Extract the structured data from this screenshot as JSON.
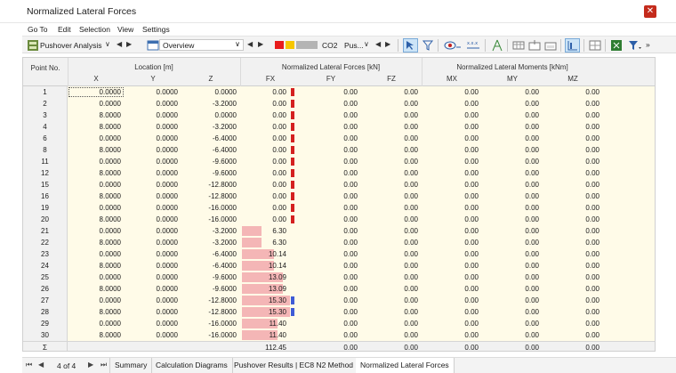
{
  "window": {
    "title": "Normalized Lateral Forces"
  },
  "menu": [
    "Go To",
    "Edit",
    "Selection",
    "View",
    "Settings"
  ],
  "toolbar": {
    "analysis_label": "Pushover Analysis",
    "view_label": "Overview",
    "combo_code": "CO2",
    "combo_name": "Pus...",
    "colors": {
      "red": "#e81c1c",
      "yellow": "#f7c600",
      "gray": "#b4b4b4"
    }
  },
  "table": {
    "headers": {
      "point_no": "Point No.",
      "location": "Location [m]",
      "forces": "Normalized Lateral Forces [kN]",
      "moments": "Normalized Lateral Moments [kNm]",
      "cols": [
        "X",
        "Y",
        "Z",
        "FX",
        "FY",
        "FZ",
        "MX",
        "MY",
        "MZ"
      ]
    },
    "rows": [
      {
        "no": "1",
        "x": "0.0000",
        "y": "0.0000",
        "z": "0.0000",
        "fx": "0.00",
        "fy": "0.00",
        "fz": "0.00",
        "mx": "0.00",
        "my": "0.00",
        "mz": "0.00",
        "fx_val": 0.0,
        "mark": "red"
      },
      {
        "no": "2",
        "x": "0.0000",
        "y": "0.0000",
        "z": "-3.2000",
        "fx": "0.00",
        "fy": "0.00",
        "fz": "0.00",
        "mx": "0.00",
        "my": "0.00",
        "mz": "0.00",
        "fx_val": 0.0,
        "mark": "red"
      },
      {
        "no": "3",
        "x": "8.0000",
        "y": "0.0000",
        "z": "0.0000",
        "fx": "0.00",
        "fy": "0.00",
        "fz": "0.00",
        "mx": "0.00",
        "my": "0.00",
        "mz": "0.00",
        "fx_val": 0.0,
        "mark": "red"
      },
      {
        "no": "4",
        "x": "8.0000",
        "y": "0.0000",
        "z": "-3.2000",
        "fx": "0.00",
        "fy": "0.00",
        "fz": "0.00",
        "mx": "0.00",
        "my": "0.00",
        "mz": "0.00",
        "fx_val": 0.0,
        "mark": "red"
      },
      {
        "no": "6",
        "x": "0.0000",
        "y": "0.0000",
        "z": "-6.4000",
        "fx": "0.00",
        "fy": "0.00",
        "fz": "0.00",
        "mx": "0.00",
        "my": "0.00",
        "mz": "0.00",
        "fx_val": 0.0,
        "mark": "red"
      },
      {
        "no": "8",
        "x": "8.0000",
        "y": "0.0000",
        "z": "-6.4000",
        "fx": "0.00",
        "fy": "0.00",
        "fz": "0.00",
        "mx": "0.00",
        "my": "0.00",
        "mz": "0.00",
        "fx_val": 0.0,
        "mark": "red"
      },
      {
        "no": "11",
        "x": "0.0000",
        "y": "0.0000",
        "z": "-9.6000",
        "fx": "0.00",
        "fy": "0.00",
        "fz": "0.00",
        "mx": "0.00",
        "my": "0.00",
        "mz": "0.00",
        "fx_val": 0.0,
        "mark": "red"
      },
      {
        "no": "12",
        "x": "8.0000",
        "y": "0.0000",
        "z": "-9.6000",
        "fx": "0.00",
        "fy": "0.00",
        "fz": "0.00",
        "mx": "0.00",
        "my": "0.00",
        "mz": "0.00",
        "fx_val": 0.0,
        "mark": "red"
      },
      {
        "no": "15",
        "x": "0.0000",
        "y": "0.0000",
        "z": "-12.8000",
        "fx": "0.00",
        "fy": "0.00",
        "fz": "0.00",
        "mx": "0.00",
        "my": "0.00",
        "mz": "0.00",
        "fx_val": 0.0,
        "mark": "red"
      },
      {
        "no": "16",
        "x": "8.0000",
        "y": "0.0000",
        "z": "-12.8000",
        "fx": "0.00",
        "fy": "0.00",
        "fz": "0.00",
        "mx": "0.00",
        "my": "0.00",
        "mz": "0.00",
        "fx_val": 0.0,
        "mark": "red"
      },
      {
        "no": "19",
        "x": "0.0000",
        "y": "0.0000",
        "z": "-16.0000",
        "fx": "0.00",
        "fy": "0.00",
        "fz": "0.00",
        "mx": "0.00",
        "my": "0.00",
        "mz": "0.00",
        "fx_val": 0.0,
        "mark": "red"
      },
      {
        "no": "20",
        "x": "8.0000",
        "y": "0.0000",
        "z": "-16.0000",
        "fx": "0.00",
        "fy": "0.00",
        "fz": "0.00",
        "mx": "0.00",
        "my": "0.00",
        "mz": "0.00",
        "fx_val": 0.0,
        "mark": "red"
      },
      {
        "no": "21",
        "x": "0.0000",
        "y": "0.0000",
        "z": "-3.2000",
        "fx": "6.30",
        "fy": "0.00",
        "fz": "0.00",
        "mx": "0.00",
        "my": "0.00",
        "mz": "0.00",
        "fx_val": 6.3,
        "mark": ""
      },
      {
        "no": "22",
        "x": "8.0000",
        "y": "0.0000",
        "z": "-3.2000",
        "fx": "6.30",
        "fy": "0.00",
        "fz": "0.00",
        "mx": "0.00",
        "my": "0.00",
        "mz": "0.00",
        "fx_val": 6.3,
        "mark": ""
      },
      {
        "no": "23",
        "x": "0.0000",
        "y": "0.0000",
        "z": "-6.4000",
        "fx": "10.14",
        "fy": "0.00",
        "fz": "0.00",
        "mx": "0.00",
        "my": "0.00",
        "mz": "0.00",
        "fx_val": 10.14,
        "mark": ""
      },
      {
        "no": "24",
        "x": "8.0000",
        "y": "0.0000",
        "z": "-6.4000",
        "fx": "10.14",
        "fy": "0.00",
        "fz": "0.00",
        "mx": "0.00",
        "my": "0.00",
        "mz": "0.00",
        "fx_val": 10.14,
        "mark": ""
      },
      {
        "no": "25",
        "x": "0.0000",
        "y": "0.0000",
        "z": "-9.6000",
        "fx": "13.09",
        "fy": "0.00",
        "fz": "0.00",
        "mx": "0.00",
        "my": "0.00",
        "mz": "0.00",
        "fx_val": 13.09,
        "mark": ""
      },
      {
        "no": "26",
        "x": "8.0000",
        "y": "0.0000",
        "z": "-9.6000",
        "fx": "13.09",
        "fy": "0.00",
        "fz": "0.00",
        "mx": "0.00",
        "my": "0.00",
        "mz": "0.00",
        "fx_val": 13.09,
        "mark": ""
      },
      {
        "no": "27",
        "x": "0.0000",
        "y": "0.0000",
        "z": "-12.8000",
        "fx": "15.30",
        "fy": "0.00",
        "fz": "0.00",
        "mx": "0.00",
        "my": "0.00",
        "mz": "0.00",
        "fx_val": 15.3,
        "mark": "blue"
      },
      {
        "no": "28",
        "x": "8.0000",
        "y": "0.0000",
        "z": "-12.8000",
        "fx": "15.30",
        "fy": "0.00",
        "fz": "0.00",
        "mx": "0.00",
        "my": "0.00",
        "mz": "0.00",
        "fx_val": 15.3,
        "mark": "blue"
      },
      {
        "no": "29",
        "x": "0.0000",
        "y": "0.0000",
        "z": "-16.0000",
        "fx": "11.40",
        "fy": "0.00",
        "fz": "0.00",
        "mx": "0.00",
        "my": "0.00",
        "mz": "0.00",
        "fx_val": 11.4,
        "mark": ""
      },
      {
        "no": "30",
        "x": "8.0000",
        "y": "0.0000",
        "z": "-16.0000",
        "fx": "11.40",
        "fy": "0.00",
        "fz": "0.00",
        "mx": "0.00",
        "my": "0.00",
        "mz": "0.00",
        "fx_val": 11.4,
        "mark": ""
      }
    ],
    "sum": {
      "no": "Σ",
      "fx": "112.45",
      "fy": "0.00",
      "fz": "0.00",
      "mx": "0.00",
      "my": "0.00",
      "mz": "0.00"
    },
    "fx_bar_max": 15.3,
    "bar_color": "#f4b6b6",
    "mark_colors": {
      "red": "#d42020",
      "blue": "#3e5bd6"
    }
  },
  "bottom": {
    "page": "4 of 4",
    "tabs": [
      "Summary",
      "Calculation Diagrams",
      "Pushover Results | EC8 N2 Method",
      "Normalized Lateral Forces"
    ],
    "active_tab": 3
  }
}
